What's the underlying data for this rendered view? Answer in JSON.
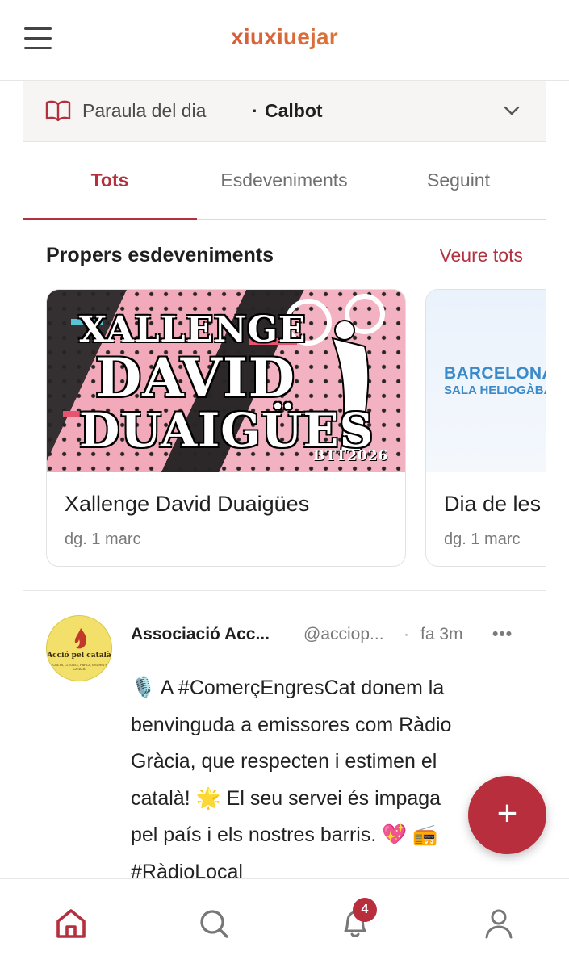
{
  "app": {
    "logo_text": "xiuxiuejar",
    "accent_color": "#b3303e"
  },
  "word_of_day": {
    "label": "Paraula del dia",
    "separator": "·",
    "word": "Calbot"
  },
  "tabs": [
    {
      "label": "Tots",
      "active": true
    },
    {
      "label": "Esdeveniments",
      "active": false
    },
    {
      "label": "Seguint",
      "active": false
    }
  ],
  "events_section": {
    "title": "Propers esdeveniments",
    "see_all": "Veure tots",
    "cards": [
      {
        "title": "Xallenge David Duaigües",
        "date": "dg. 1 marc",
        "poster": {
          "line1": "XALLENGE",
          "line2": "DAVID",
          "line3": "DUAIGÜES",
          "line4": "BTT2026"
        }
      },
      {
        "title": "Dia de les",
        "date": "dg. 1 marc",
        "poster": {
          "city": "BARCELONA",
          "hall": "SALA HELIOGÀBAL"
        }
      }
    ]
  },
  "post": {
    "author": "Associació Acc...",
    "handle": "@acciop...",
    "separator": "·",
    "time": "fa 3m",
    "more": "•••",
    "avatar": {
      "name": "Acció pel català",
      "slogan": "ESCOLTA, LLEGEIX, PARLA, ESCRIU EN CATALÀ"
    },
    "lines": [
      "🎙️  A #ComerçEngresCat donem la",
      "benvinguda a emissores com Ràdio",
      "Gràcia, que respecten i estimen el",
      "català! 🌟  El seu servei és impaga",
      "pel país i els nostres barris. 💖 📻",
      "#RàdioLocal"
    ]
  },
  "fab": {
    "label": "+"
  },
  "bottom_nav": {
    "items": [
      "home-icon",
      "search-icon",
      "bell-icon",
      "profile-icon"
    ],
    "notification_count": "4"
  }
}
